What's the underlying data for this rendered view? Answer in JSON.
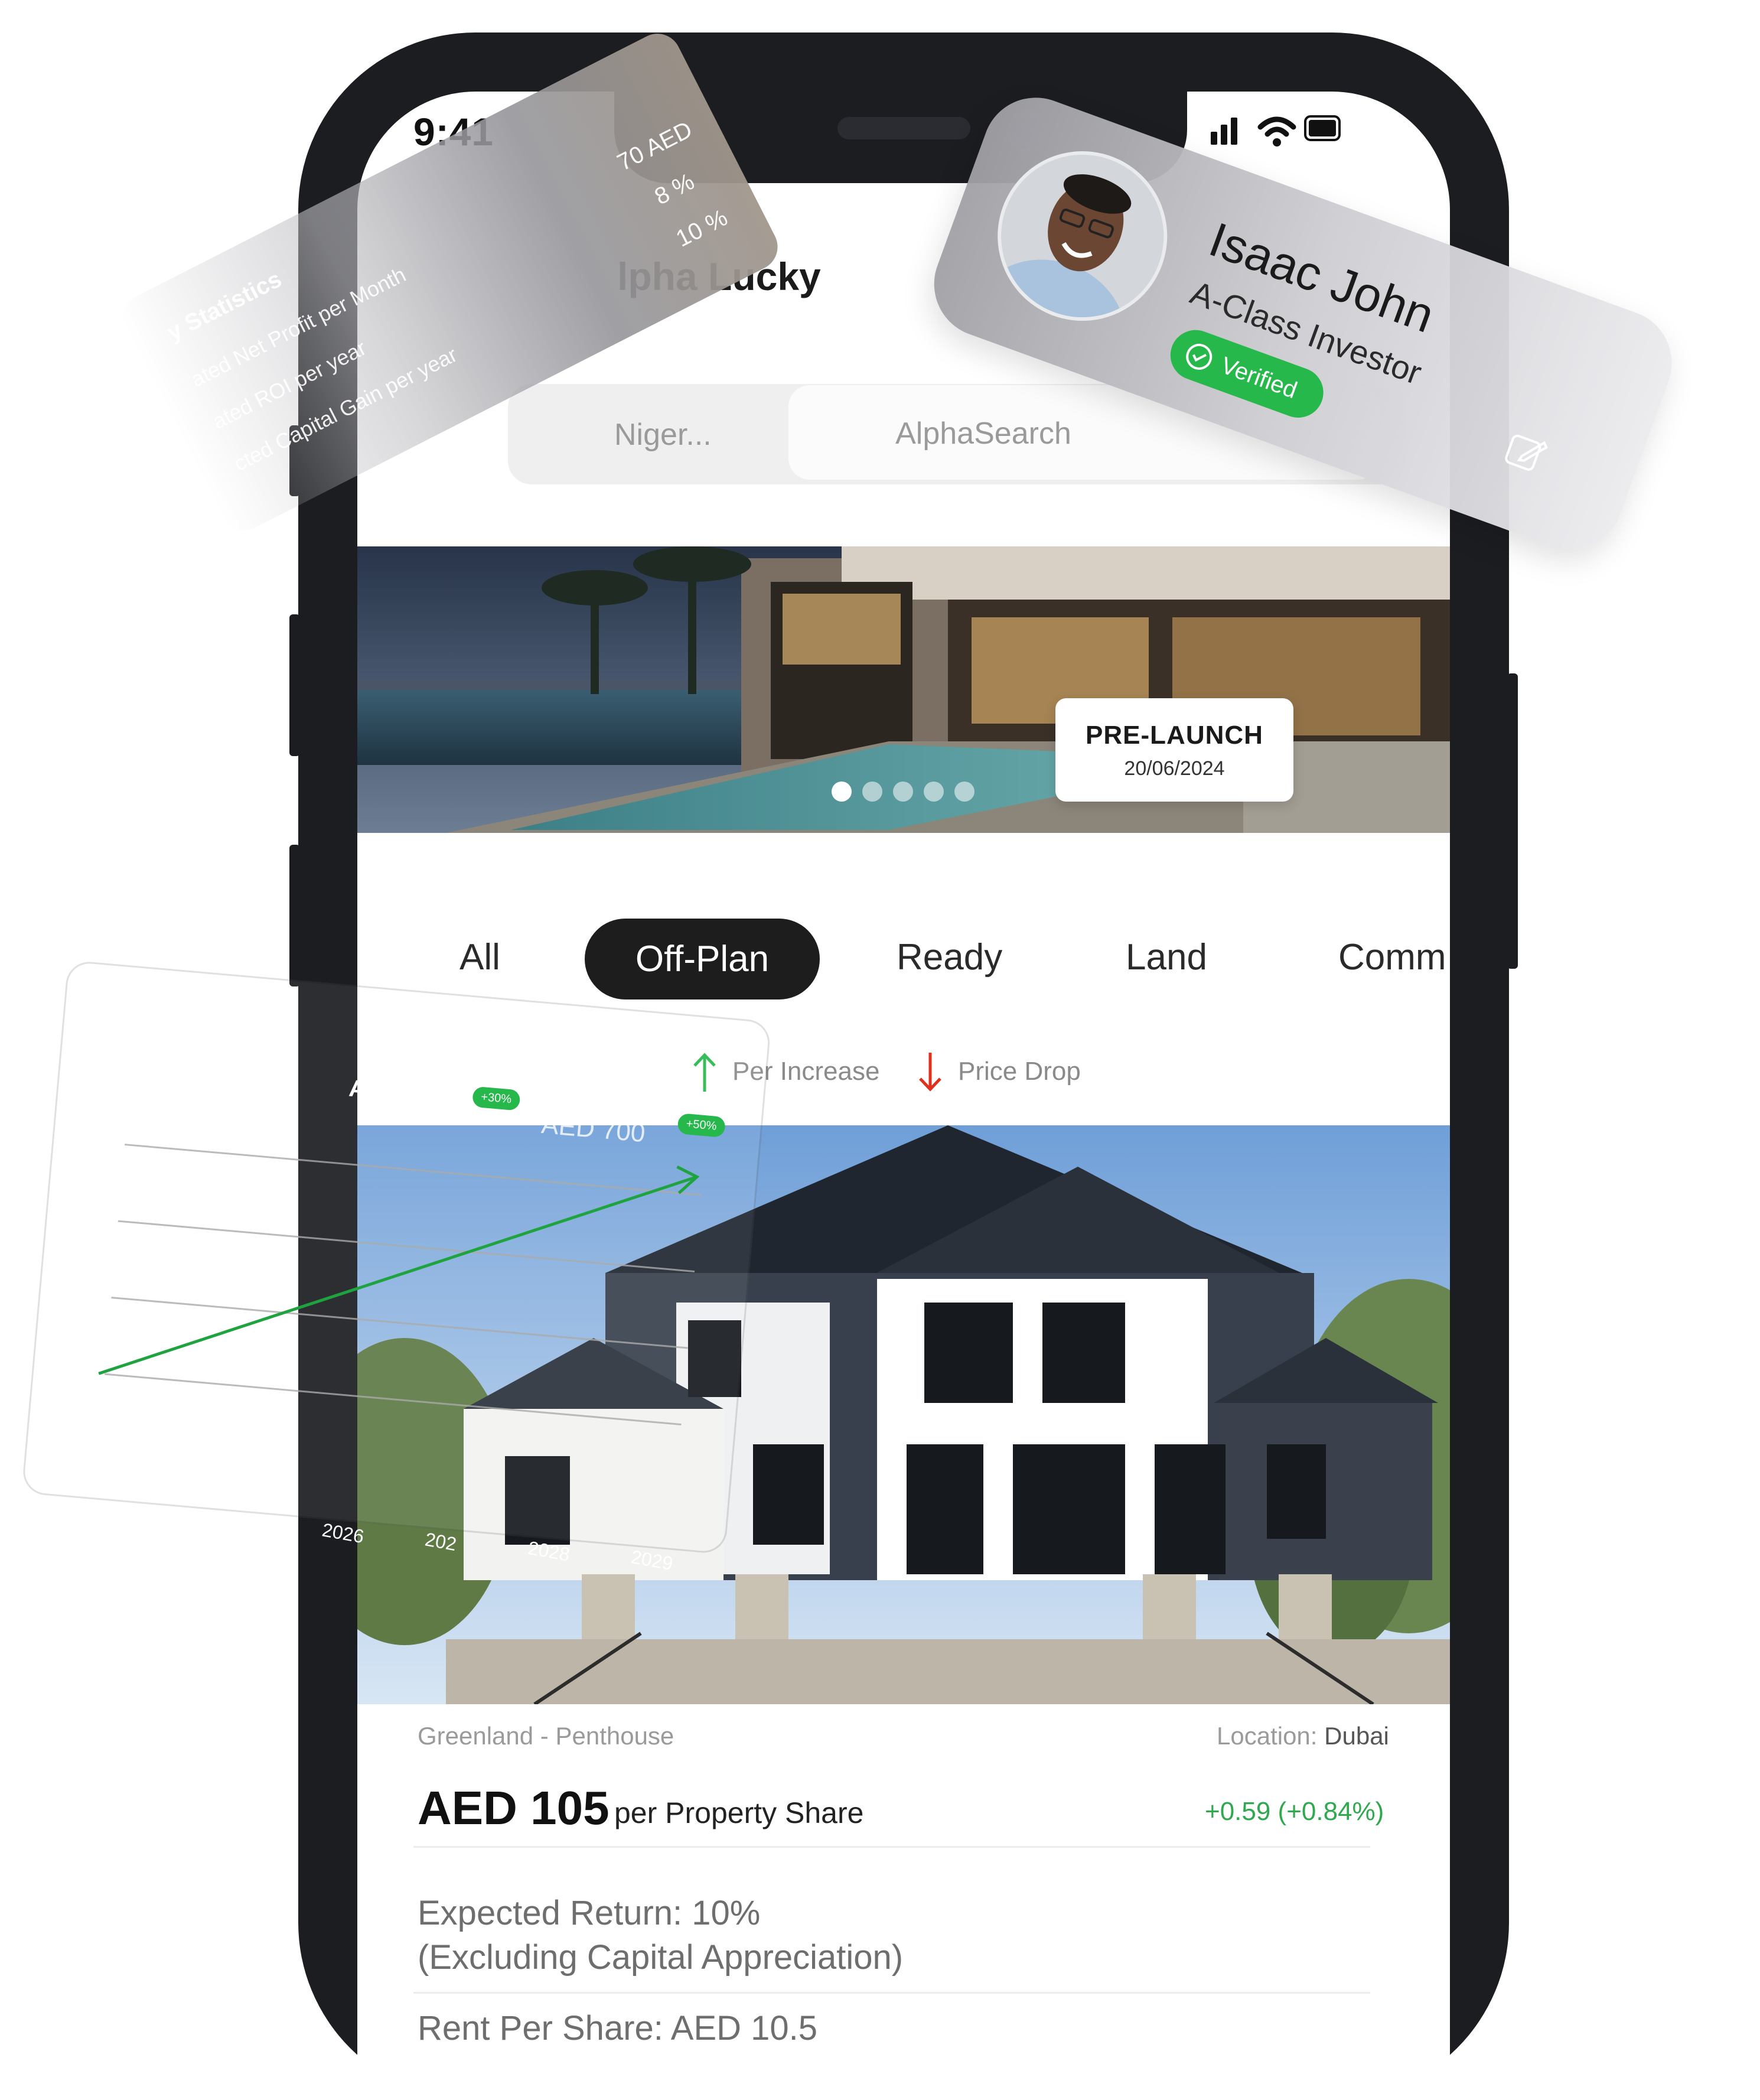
{
  "status_bar": {
    "time": "9:41"
  },
  "header": {
    "greeting": "lpha Lucky"
  },
  "search": {
    "location": "Niger...",
    "placeholder": "AlphaSearch"
  },
  "banner": {
    "badge_title": "PRE-LAUNCH",
    "badge_date": "20/06/2024",
    "slide_count": 5,
    "active_slide": 1
  },
  "tabs": [
    {
      "label": "All",
      "active": false
    },
    {
      "label": "Off-Plan",
      "active": true
    },
    {
      "label": "Ready",
      "active": false
    },
    {
      "label": "Land",
      "active": false
    },
    {
      "label": "Comm",
      "active": false
    }
  ],
  "legend": {
    "increase": "Per Increase",
    "drop": "Price Drop"
  },
  "property": {
    "title": "Greenland - Penthouse",
    "location_label": "Location:",
    "location_value": "Dubai",
    "price": "AED 105",
    "price_unit": "per Property Share",
    "change": "+0.59 (+0.84%)",
    "expected_return": "Expected Return:   10%",
    "expected_note": "(Excluding Capital Appreciation)",
    "next_line": "Rent Per Share:  AED 10.5"
  },
  "stats_card": {
    "title": "y Statistics",
    "rows": [
      {
        "label": "ated Net Profit per Month",
        "value": "70 AED"
      },
      {
        "label": "ated ROI per year",
        "value": "8 %"
      },
      {
        "label": "cted Capital Gain per year",
        "value": "10 %"
      }
    ]
  },
  "profile_card": {
    "name": "Isaac John",
    "role": "A-Class Investor",
    "status": "Verified"
  },
  "chart_card": {
    "header_fragment": "A",
    "value_fragment": "AED 700",
    "pill_1": "+30%",
    "pill_2": "+50%",
    "years": [
      "2026",
      "202",
      "2028",
      "2029"
    ]
  },
  "colors": {
    "accent_green": "#27b84b",
    "price_drop_red": "#e0301e",
    "dark": "#1d1d1d"
  }
}
